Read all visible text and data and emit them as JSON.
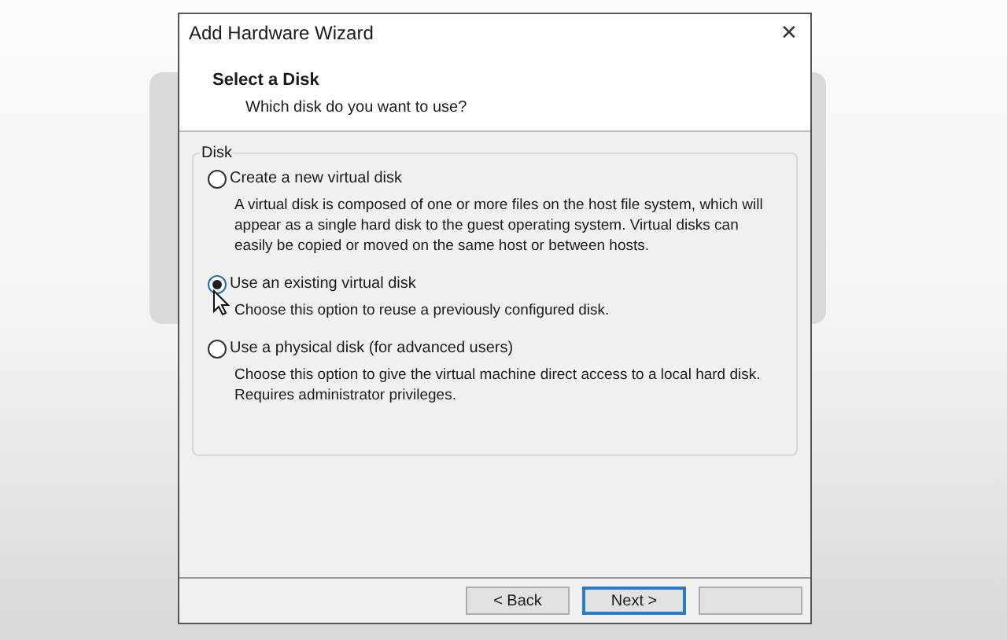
{
  "window": {
    "title": "Add Hardware Wizard",
    "close": "✕"
  },
  "header": {
    "title": "Select a Disk",
    "subtitle": "Which disk do you want to use?"
  },
  "group": {
    "label": "Disk",
    "options": [
      {
        "label": "Create a new virtual disk",
        "description": "A virtual disk is composed of one or more files on the host file system, which will appear as a single hard disk to the guest operating system. Virtual disks can easily be copied or moved on the same host or between hosts.",
        "selected": false
      },
      {
        "label": "Use an existing virtual disk",
        "description": "Choose this option to reuse a previously configured disk.",
        "selected": true
      },
      {
        "label": "Use a physical disk (for advanced users)",
        "description": "Choose this option to give the virtual machine direct access to a local hard disk. Requires administrator privileges.",
        "selected": false
      }
    ]
  },
  "buttons": [
    {
      "label": "< Back",
      "default": false
    },
    {
      "label": "Next >",
      "default": true
    },
    {
      "default": false
    }
  ]
}
